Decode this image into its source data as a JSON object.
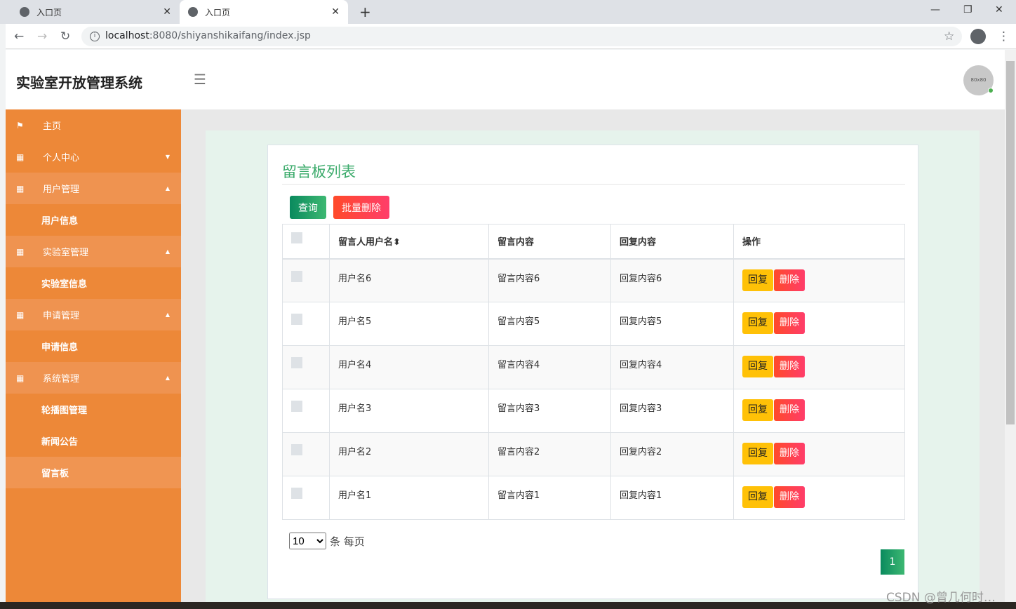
{
  "browser": {
    "tabs": [
      {
        "title": "入口页"
      },
      {
        "title": "入口页"
      }
    ],
    "url_host": "localhost",
    "url_path": ":8080/shiyanshikaifang/index.jsp"
  },
  "header": {
    "brand": "实验室开放管理系统",
    "avatar_text": "80x80"
  },
  "sidebar": {
    "items": [
      {
        "label": "主页",
        "type": "top",
        "icon": "flag-icon"
      },
      {
        "label": "个人中心",
        "type": "grp",
        "icon": "grid-icon",
        "caret": "▼"
      },
      {
        "label": "用户管理",
        "type": "open",
        "icon": "grid-icon",
        "caret": "▲"
      },
      {
        "label": "用户信息",
        "type": "sub"
      },
      {
        "label": "实验室管理",
        "type": "open",
        "icon": "grid-icon",
        "caret": "▲"
      },
      {
        "label": "实验室信息",
        "type": "sub"
      },
      {
        "label": "申请管理",
        "type": "open",
        "icon": "grid-icon",
        "caret": "▲"
      },
      {
        "label": "申请信息",
        "type": "sub"
      },
      {
        "label": "系统管理",
        "type": "open",
        "icon": "grid-icon",
        "caret": "▲"
      },
      {
        "label": "轮播图管理",
        "type": "sub"
      },
      {
        "label": "新闻公告",
        "type": "sub"
      },
      {
        "label": "留言板",
        "type": "sub",
        "active": true
      }
    ]
  },
  "main": {
    "title": "留言板列表",
    "query_label": "查询",
    "batch_delete_label": "批量删除",
    "columns": [
      "留言人用户名",
      "留言内容",
      "回复内容",
      "操作"
    ],
    "rows": [
      [
        "用户名6",
        "留言内容6",
        "回复内容6"
      ],
      [
        "用户名5",
        "留言内容5",
        "回复内容5"
      ],
      [
        "用户名4",
        "留言内容4",
        "回复内容4"
      ],
      [
        "用户名3",
        "留言内容3",
        "回复内容3"
      ],
      [
        "用户名2",
        "留言内容2",
        "回复内容2"
      ],
      [
        "用户名1",
        "留言内容1",
        "回复内容1"
      ]
    ],
    "reply_label": "回复",
    "delete_label": "删除",
    "page_size": "10",
    "page_size_suffix": "条 每页",
    "current_page": "1"
  },
  "watermark": "CSDN @曾几何时…"
}
